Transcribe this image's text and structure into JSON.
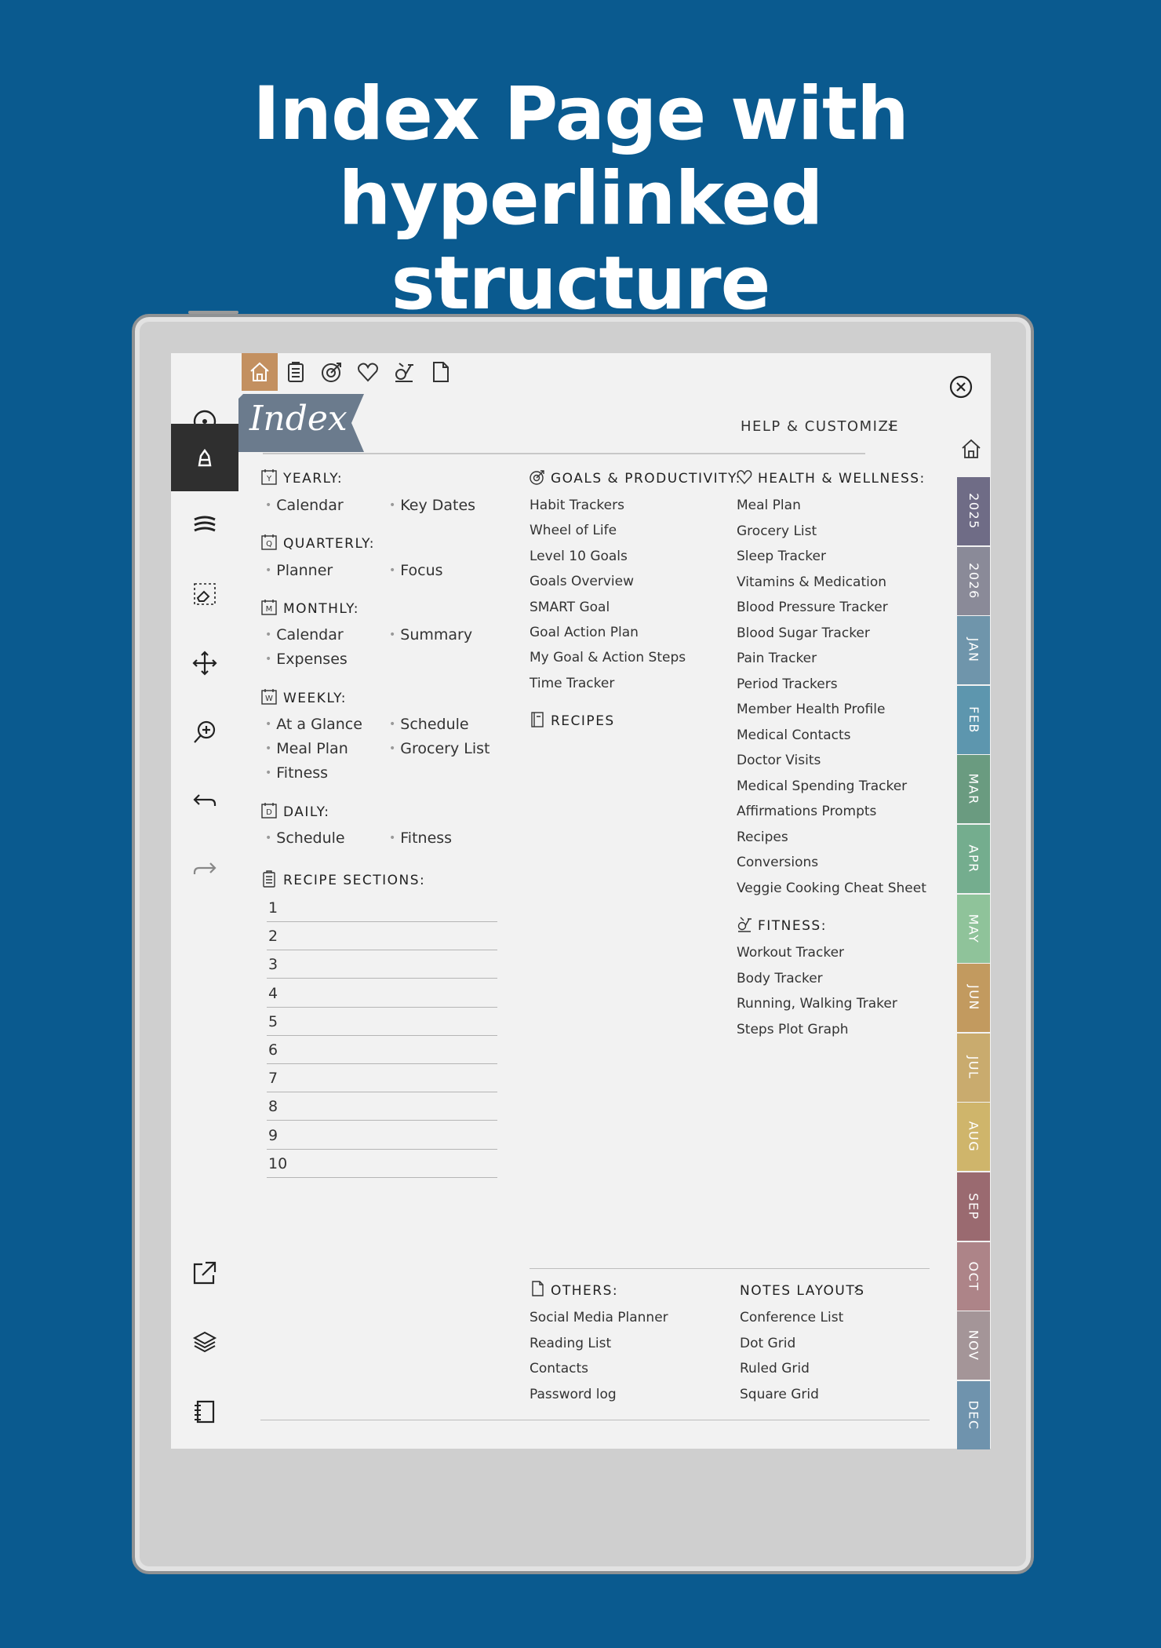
{
  "headline": {
    "line1": "Index Page with hyperlinked",
    "line2": "structure"
  },
  "header": {
    "banner": "Index",
    "help": "HELP & CUSTOMIZE"
  },
  "top_tabs": [
    {
      "icon": "home-icon"
    },
    {
      "icon": "clipboard-icon"
    },
    {
      "icon": "goal-icon"
    },
    {
      "icon": "heart-icon"
    },
    {
      "icon": "fitness-bike-icon"
    },
    {
      "icon": "page-icon"
    }
  ],
  "left_tools": [
    {
      "icon": "cursor-dot-icon"
    },
    {
      "icon": "pen-icon"
    },
    {
      "icon": "waves-icon"
    },
    {
      "icon": "eraser-select-icon"
    },
    {
      "icon": "move-icon"
    },
    {
      "icon": "zoom-icon"
    },
    {
      "icon": "undo-icon"
    },
    {
      "icon": "redo-icon"
    },
    {
      "icon": "export-icon"
    },
    {
      "icon": "layers-icon"
    },
    {
      "icon": "notebook-icon"
    }
  ],
  "yearly": {
    "letter": "Y",
    "title": "YEARLY:",
    "items": [
      "Calendar",
      "Key Dates"
    ]
  },
  "quarterly": {
    "letter": "Q",
    "title": "QUARTERLY:",
    "items": [
      "Planner",
      "Focus"
    ]
  },
  "monthly": {
    "letter": "M",
    "title": "MONTHLY:",
    "items": [
      "Calendar",
      "Summary",
      "Expenses"
    ]
  },
  "weekly": {
    "letter": "W",
    "title": "WEEKLY:",
    "items": [
      "At a Glance",
      "Schedule",
      "Meal Plan",
      "Grocery List",
      "Fitness"
    ]
  },
  "daily": {
    "letter": "D",
    "title": "DAILY:",
    "items": [
      "Schedule",
      "Fitness"
    ]
  },
  "recipe_sections": {
    "title": "RECIPE SECTIONS:",
    "items": [
      "1",
      "2",
      "3",
      "4",
      "5",
      "6",
      "7",
      "8",
      "9",
      "10"
    ]
  },
  "goals": {
    "title": "GOALS & PRODUCTIVITY:",
    "items": [
      "Habit Trackers",
      "Wheel of Life",
      "Level 10 Goals",
      "Goals Overview",
      "SMART Goal",
      "Goal Action Plan",
      "My Goal & Action Steps",
      "Time Tracker"
    ]
  },
  "recipes": {
    "title": "RECIPES"
  },
  "health": {
    "title": "HEALTH & WELLNESS:",
    "items": [
      "Meal Plan",
      "Grocery List",
      "Sleep Tracker",
      "Vitamins & Medication",
      "Blood Pressure Tracker",
      "Blood Sugar Tracker",
      "Pain Tracker",
      "Period Trackers",
      "Member Health Profile",
      "Medical Contacts",
      "Doctor Visits",
      "Medical Spending Tracker",
      "Affirmations Prompts",
      "Recipes",
      "Conversions",
      "Veggie Cooking Cheat Sheet"
    ]
  },
  "fitness": {
    "title": "FITNESS:",
    "items": [
      "Workout Tracker",
      "Body Tracker",
      "Running, Walking Traker",
      "Steps Plot Graph"
    ]
  },
  "others": {
    "title": "OTHERS:",
    "items": [
      "Social Media Planner",
      "Reading List",
      "Contacts",
      "Password log"
    ]
  },
  "notes_layouts": {
    "title": "NOTES LAYOUTS",
    "items": [
      "Conference List",
      "Dot Grid",
      "Ruled Grid",
      "Square Grid"
    ]
  },
  "month_tabs": [
    {
      "label": "2025",
      "color": "#6f6c86"
    },
    {
      "label": "2026",
      "color": "#8a8a98"
    },
    {
      "label": "JAN",
      "color": "#6f95ab"
    },
    {
      "label": "FEB",
      "color": "#5d96ae"
    },
    {
      "label": "MAR",
      "color": "#6a9b80"
    },
    {
      "label": "APR",
      "color": "#74ad8e"
    },
    {
      "label": "MAY",
      "color": "#8fc39a"
    },
    {
      "label": "JUN",
      "color": "#c29a5f"
    },
    {
      "label": "JUL",
      "color": "#c9ab6e"
    },
    {
      "label": "AUG",
      "color": "#cfb56b"
    },
    {
      "label": "SEP",
      "color": "#9a6a70"
    },
    {
      "label": "OCT",
      "color": "#ad8488"
    },
    {
      "label": "NOV",
      "color": "#a49598"
    },
    {
      "label": "DEC",
      "color": "#6f93ad"
    }
  ],
  "colors": {
    "background": "#0a5a8f",
    "accent": "#c39060",
    "banner": "#6b7b8d"
  }
}
